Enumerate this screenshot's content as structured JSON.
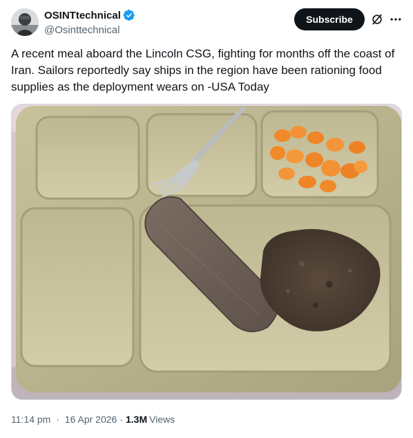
{
  "author": {
    "name": "OSINTtechnical",
    "handle": "@Osinttechnical",
    "verified": true,
    "verified_color": "#1d9bf0"
  },
  "actions": {
    "subscribe_label": "Subscribe",
    "grok_icon": "grok-icon",
    "more_icon": "more-dots-icon"
  },
  "tweet": {
    "text": "A recent meal aboard the Lincoln CSG, fighting for months off the coast of Iran. Sailors reportedly say ships in the region have been rationing food supplies as the deployment wears on -USA Today"
  },
  "media": {
    "description_icon": "photo-of-meal-tray"
  },
  "meta": {
    "time": "11:14 pm",
    "date": "16 Apr 2026",
    "separator": "·",
    "views_count": "1.3M",
    "views_label": "Views"
  },
  "colors": {
    "text_primary": "#0f1419",
    "text_secondary": "#536471",
    "button_bg": "#0f1419"
  }
}
